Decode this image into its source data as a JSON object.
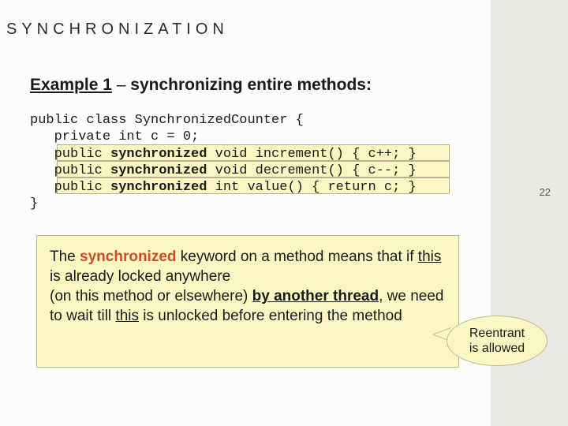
{
  "slide": {
    "title": "SYNCHRONIZATION",
    "number": "22"
  },
  "subtitle": {
    "label": "Example 1",
    "dash": " – ",
    "rest": "synchronizing entire methods:"
  },
  "code": {
    "l1a": "public class Synchronized",
    "l1b": "Counter {",
    "l2": "   private int c = 0;",
    "l3a": "   public ",
    "l3k": "synchronized",
    "l3b": " void increment() { c++; }",
    "l4a": "   public ",
    "l4k": "synchronized",
    "l4b": " void decrement() { c--; }",
    "l5a": "   public ",
    "l5k": "synchronized",
    "l5b": " int value() { return c; }",
    "l6": "}"
  },
  "explain": {
    "p1": "The ",
    "sync": "synchronized",
    "p2": " keyword on a method means that if ",
    "this1": "this",
    "p3": " is already locked anywhere",
    "p4": "(on this method or elsewhere) ",
    "byt": "by another thread",
    "p5": ", we need to wait till ",
    "this2": "this",
    "p6": " is unlocked before entering the method"
  },
  "bubble": {
    "line1": "Reentrant",
    "line2": "is allowed"
  }
}
